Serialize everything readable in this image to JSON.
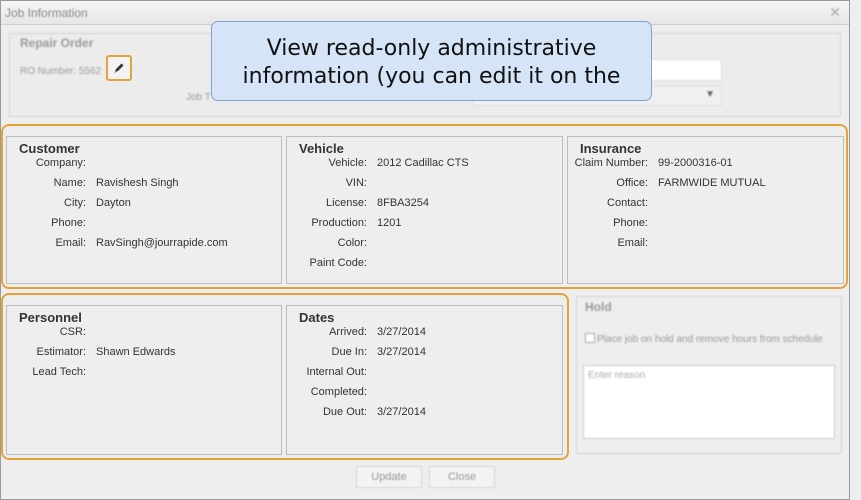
{
  "window": {
    "title": "Job Information",
    "close_glyph": "✕"
  },
  "repair_order": {
    "legend": "Repair Order",
    "ro_number_label": "RO Number: 5562",
    "edit_icon": "pencil-icon",
    "job_type_label": "Job T",
    "select_arrow": "▼"
  },
  "callout": {
    "line1": "View read-only administrative",
    "line2": "information (you can edit it on the"
  },
  "customer": {
    "title": "Customer",
    "rows": [
      {
        "label": "Company:",
        "value": ""
      },
      {
        "label": "Name:",
        "value": "Ravishesh Singh"
      },
      {
        "label": "City:",
        "value": "Dayton"
      },
      {
        "label": "Phone:",
        "value": ""
      },
      {
        "label": "Email:",
        "value": "RavSingh@jourrapide.com"
      }
    ]
  },
  "vehicle": {
    "title": "Vehicle",
    "rows": [
      {
        "label": "Vehicle:",
        "value": "2012 Cadillac CTS"
      },
      {
        "label": "VIN:",
        "value": ""
      },
      {
        "label": "License:",
        "value": "8FBA3254"
      },
      {
        "label": "Production:",
        "value": "1201"
      },
      {
        "label": "Color:",
        "value": ""
      },
      {
        "label": "Paint Code:",
        "value": ""
      }
    ]
  },
  "insurance": {
    "title": "Insurance",
    "rows": [
      {
        "label": "Claim Number:",
        "value": "99-2000316-01"
      },
      {
        "label": "Office:",
        "value": "FARMWIDE MUTUAL"
      },
      {
        "label": "Contact:",
        "value": ""
      },
      {
        "label": "Phone:",
        "value": ""
      },
      {
        "label": "Email:",
        "value": ""
      }
    ]
  },
  "personnel": {
    "title": "Personnel",
    "rows": [
      {
        "label": "CSR:",
        "value": ""
      },
      {
        "label": "Estimator:",
        "value": "Shawn Edwards"
      },
      {
        "label": "Lead Tech:",
        "value": ""
      }
    ]
  },
  "dates": {
    "title": "Dates",
    "rows": [
      {
        "label": "Arrived:",
        "value": "3/27/2014"
      },
      {
        "label": "Due In:",
        "value": "3/27/2014"
      },
      {
        "label": "Internal Out:",
        "value": ""
      },
      {
        "label": "Completed:",
        "value": ""
      },
      {
        "label": "Due Out:",
        "value": "3/27/2014"
      }
    ]
  },
  "hold": {
    "title": "Hold",
    "checkbox_label": "Place job on hold and remove hours from schedule",
    "reason_placeholder": "Enter reason"
  },
  "buttons": {
    "update": "Update",
    "close": "Close"
  },
  "colors": {
    "highlight": "#e4a33a",
    "callout_bg": "#d5e4f6"
  }
}
